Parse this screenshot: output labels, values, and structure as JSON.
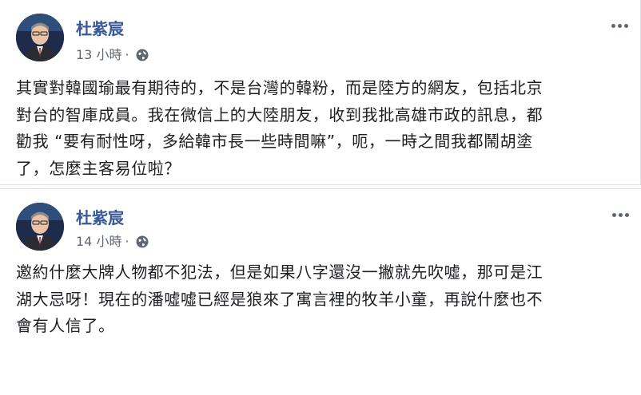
{
  "posts": [
    {
      "author": "杜紫宸",
      "time": "13 小時",
      "separator": "·",
      "privacy_icon": "globe-icon",
      "more_icon": "more-options-icon",
      "text": "其實對韓國瑜最有期待的，不是台灣的韓粉，而是陸方的網友，包括北京\n對台的智庫成員。我在微信上的大陸朋友，收到我批高雄市政的訊息，都\n勸我 “要有耐性呀，多給韓市長一些時間嘛”，呃，一時之間我都鬧胡塗\n了，怎麼主客易位啦？"
    },
    {
      "author": "杜紫宸",
      "time": "14 小時",
      "separator": "·",
      "privacy_icon": "globe-icon",
      "more_icon": "more-options-icon",
      "text": "邀約什麼大牌人物都不犯法，但是如果八字還沒一撇就先吹噓，那可是江\n湖大忌呀！現在的潘噓噓已經是狼來了寓言裡的牧羊小童，再說什麼也不\n會有人信了。"
    }
  ],
  "colors": {
    "author_link": "#385898",
    "meta_text": "#606770",
    "body_text": "#1c1e21",
    "divider": "#dddfe2"
  }
}
